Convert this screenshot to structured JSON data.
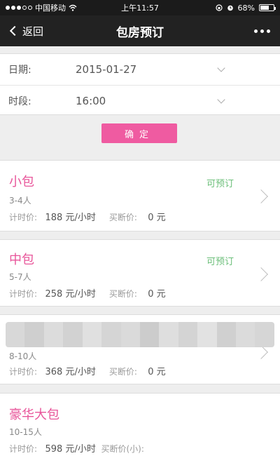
{
  "status_bar": {
    "carrier": "中国移动",
    "time": "上午11:57",
    "battery": "68%",
    "battery_level": 0.68
  },
  "nav": {
    "back_label": "返回",
    "title": "包房预订"
  },
  "form": {
    "date_label": "日期:",
    "date_value": "2015-01-27",
    "period_label": "时段:",
    "period_value": "16:00",
    "confirm_label": "确定"
  },
  "rooms": [
    {
      "name": "小包",
      "status": "可预订",
      "capacity": "3-4人",
      "hourly_label": "计时价:",
      "hourly_price": "188 元/小时",
      "buyout_label": "买断价:",
      "buyout_price": "0 元"
    },
    {
      "name": "中包",
      "status": "可预订",
      "capacity": "5-7人",
      "hourly_label": "计时价:",
      "hourly_price": "258 元/小时",
      "buyout_label": "买断价:",
      "buyout_price": "0 元"
    },
    {
      "name": "",
      "status": "",
      "capacity": "8-10人",
      "hourly_label": "计时价:",
      "hourly_price": "368 元/小时",
      "buyout_label": "买断价:",
      "buyout_price": "0 元"
    },
    {
      "name": "豪华大包",
      "status": "",
      "capacity": "10-15人",
      "hourly_label": "计时价:",
      "hourly_price": "598 元/小时",
      "buyout_label": "买断价(小):",
      "buyout_price": ""
    }
  ],
  "colors": {
    "accent": "#ef5ba1",
    "room_name": "#e8559a",
    "available": "#6cbf7a",
    "navbar": "#222222"
  }
}
